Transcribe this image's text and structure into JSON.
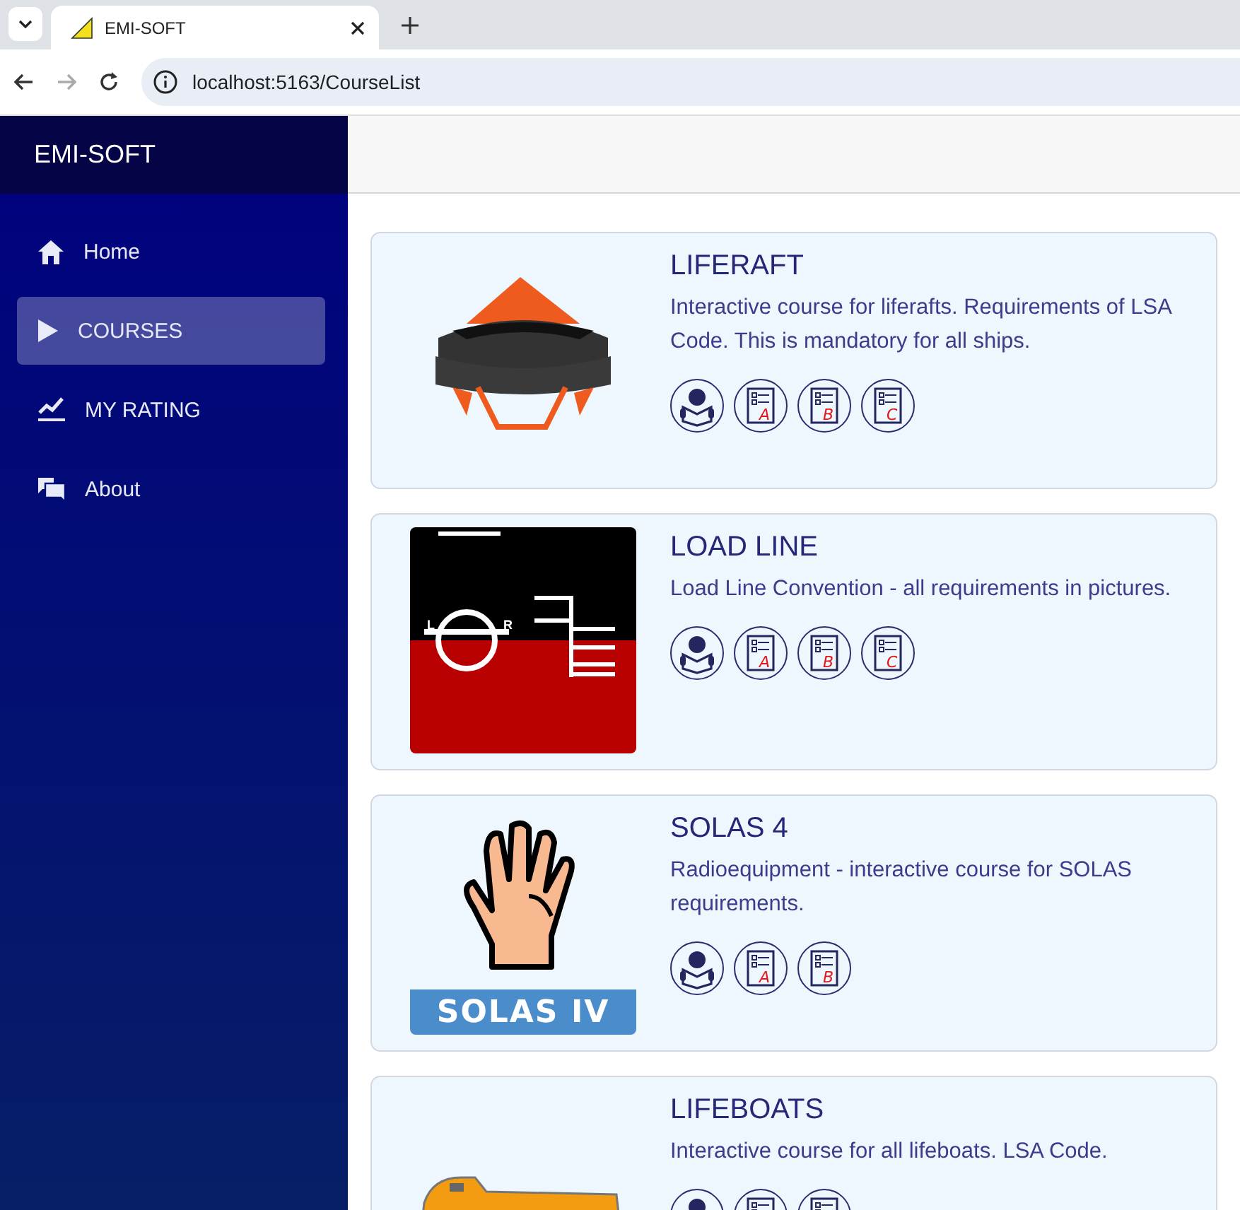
{
  "browser": {
    "tab_title": "EMI-SOFT",
    "url": "localhost:5163/CourseList"
  },
  "sidebar": {
    "brand": "EMI-SOFT",
    "items": [
      {
        "label": "Home",
        "selected": false
      },
      {
        "label": "COURSES",
        "selected": true
      },
      {
        "label": "MY RATING",
        "selected": false
      },
      {
        "label": "About",
        "selected": false
      }
    ]
  },
  "courses": [
    {
      "title": "LIFERAFT",
      "description": "Interactive course for liferafts. Requirements of LSA Code. This is mandatory for all ships.",
      "image": {
        "kind": "liferaft"
      },
      "modules": [
        {
          "kind": "study"
        },
        {
          "kind": "test",
          "letter": "A"
        },
        {
          "kind": "test",
          "letter": "B"
        },
        {
          "kind": "test",
          "letter": "C"
        }
      ]
    },
    {
      "title": "LOAD LINE",
      "description": "Load Line Convention - all requirements in pictures.",
      "image": {
        "kind": "loadline",
        "left_mark": "L",
        "right_mark": "R"
      },
      "modules": [
        {
          "kind": "study"
        },
        {
          "kind": "test",
          "letter": "A"
        },
        {
          "kind": "test",
          "letter": "B"
        },
        {
          "kind": "test",
          "letter": "C"
        }
      ]
    },
    {
      "title": "SOLAS 4",
      "description": "Radioequipment - interactive course for SOLAS requirements.",
      "image": {
        "kind": "hand",
        "caption": "SOLAS IV"
      },
      "modules": [
        {
          "kind": "study"
        },
        {
          "kind": "test",
          "letter": "A"
        },
        {
          "kind": "test",
          "letter": "B"
        }
      ]
    },
    {
      "title": "LIFEBOATS",
      "description": "Interactive course for all lifeboats. LSA Code.",
      "image": {
        "kind": "lifeboat"
      },
      "modules": [
        {
          "kind": "study"
        },
        {
          "kind": "test"
        },
        {
          "kind": "test"
        }
      ]
    }
  ]
}
